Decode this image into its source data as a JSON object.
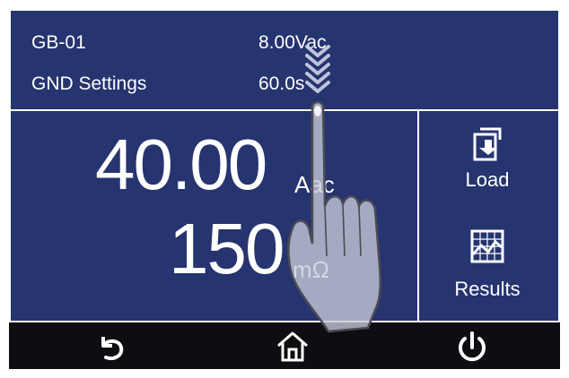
{
  "header": {
    "test_name": "GB-01",
    "test_voltage": "8.00Vac",
    "settings_label": "GND Settings",
    "dwell_time": "60.0s"
  },
  "readings": {
    "current_value": "40.00",
    "current_unit": "Aac",
    "resistance_value": "150",
    "resistance_unit": "mΩ"
  },
  "side_buttons": {
    "load_label": "Load",
    "results_label": "Results"
  },
  "nav": {
    "back_icon": "back-icon",
    "home_icon": "home-icon",
    "power_icon": "power-icon"
  },
  "colors": {
    "panel_bg": "#263470",
    "nav_bg": "#0e0e12",
    "text": "#ffffff"
  }
}
